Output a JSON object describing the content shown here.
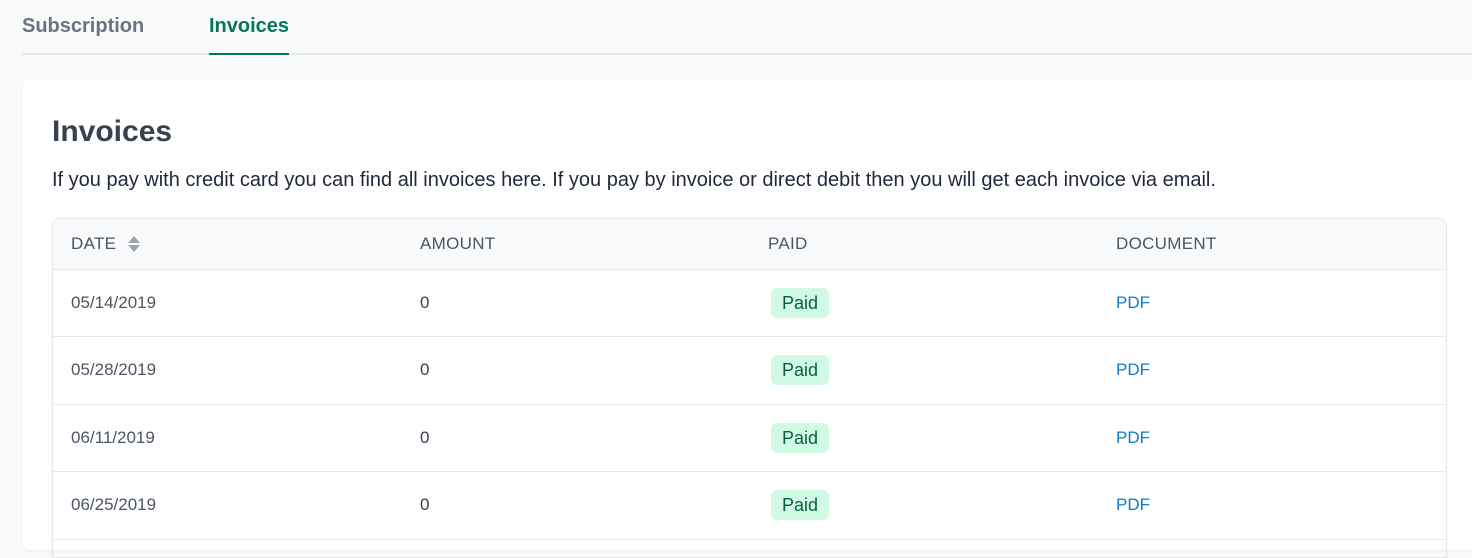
{
  "tabs": [
    {
      "label": "Subscription",
      "active": false
    },
    {
      "label": "Invoices",
      "active": true
    }
  ],
  "card": {
    "title": "Invoices",
    "description": "If you pay with credit card you can find all invoices here. If you pay by invoice or direct debit then you will get each invoice via email."
  },
  "table": {
    "headers": {
      "date": "DATE",
      "amount": "AMOUNT",
      "paid": "PAID",
      "document": "DOCUMENT"
    },
    "rows": [
      {
        "date": "05/14/2019",
        "amount": "0",
        "paid": "Paid",
        "document": "PDF"
      },
      {
        "date": "05/28/2019",
        "amount": "0",
        "paid": "Paid",
        "document": "PDF"
      },
      {
        "date": "06/11/2019",
        "amount": "0",
        "paid": "Paid",
        "document": "PDF"
      },
      {
        "date": "06/25/2019",
        "amount": "0",
        "paid": "Paid",
        "document": "PDF"
      }
    ]
  },
  "colors": {
    "accent": "#047857",
    "badge_bg": "#d1fae5",
    "badge_text": "#065f46",
    "link": "#0e7cc5"
  },
  "icons": {
    "sort": "sort-icon"
  }
}
